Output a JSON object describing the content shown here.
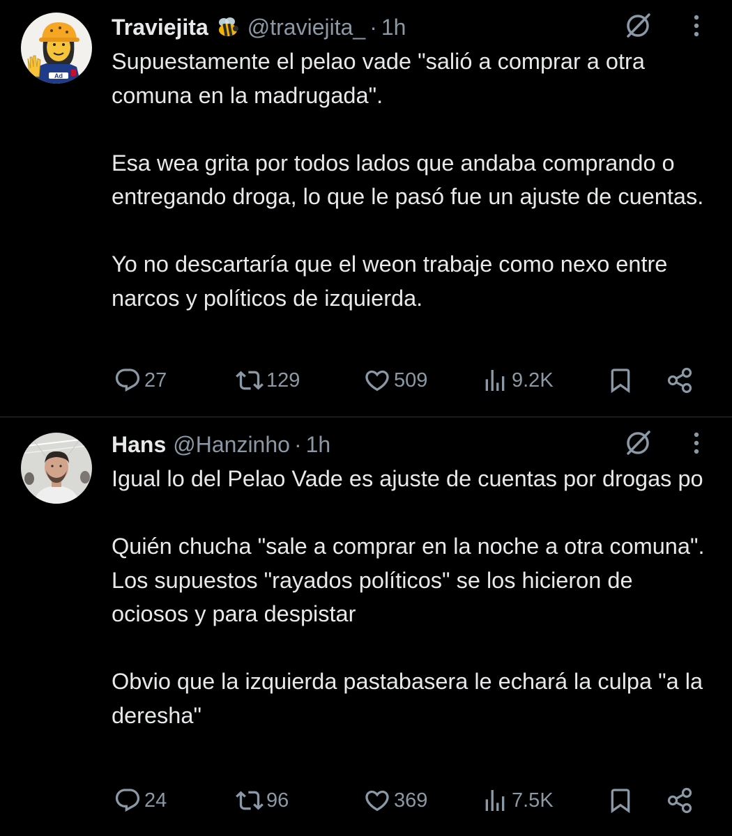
{
  "colors": {
    "background": "#000000",
    "text_primary": "#e7e9ea",
    "text_secondary": "#8b98a5",
    "divider": "#2f3336"
  },
  "tweets": [
    {
      "display_name": "Traviejita",
      "badge_icon": "bee-emoji",
      "handle": "@traviejita_",
      "separator": "·",
      "time": "1h",
      "paragraphs": [
        "Supuestamente el pelao vade \"salió a comprar a otra comuna en la madrugada\".",
        "Esa wea grita por todos lados que andaba comprando o entregando droga, lo que le pasó fue un ajuste de cuentas.",
        "Yo no descartaría que el weon trabaje como nexo entre narcos y políticos de izquierda."
      ],
      "stats": {
        "replies": "27",
        "retweets": "129",
        "likes": "509",
        "views": "9.2K"
      }
    },
    {
      "display_name": "Hans",
      "handle": "@Hanzinho",
      "separator": "·",
      "time": "1h",
      "paragraphs": [
        "Igual lo del Pelao Vade es ajuste de cuentas por drogas po",
        "Quién chucha \"sale a comprar en la noche a otra comuna\". Los supuestos \"rayados políticos\" se los hicieron de ociosos y para despistar",
        "Obvio que la izquierda pastabasera le echará la culpa \"a la deresha\""
      ],
      "stats": {
        "replies": "24",
        "retweets": "96",
        "likes": "369",
        "views": "7.5K"
      }
    }
  ]
}
